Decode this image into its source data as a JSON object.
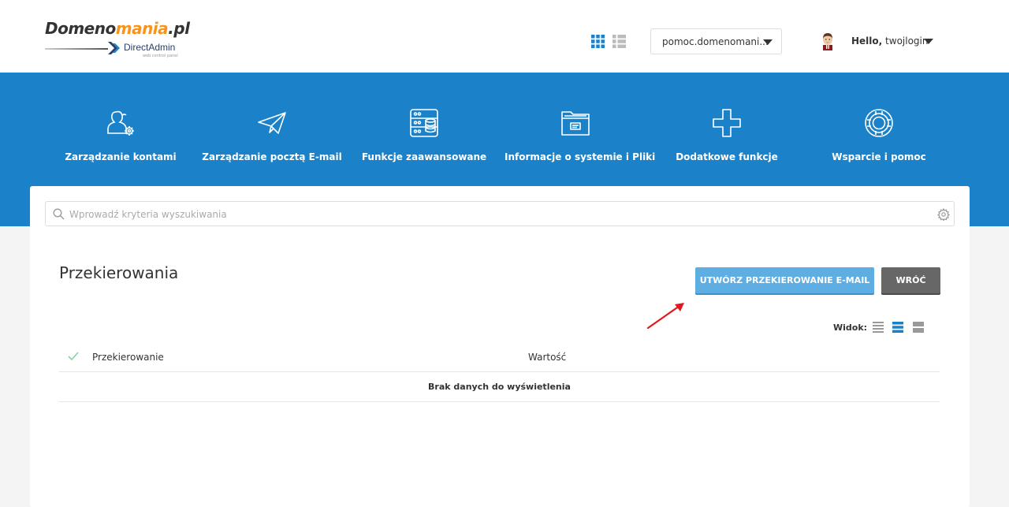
{
  "logo": {
    "part1": "Domeno",
    "part2": "mania",
    "part3": ".pl",
    "sub": "DirectAdmin",
    "tagline": "web control panel"
  },
  "header": {
    "domain": "pomoc.domenomani...",
    "greeting": "Hello,",
    "username": "twojlogin"
  },
  "nav": {
    "items": [
      {
        "label": "Zarządzanie kontami",
        "icon": "users-gear-icon"
      },
      {
        "label": "Zarządzanie pocztą E-mail",
        "icon": "paper-plane-icon"
      },
      {
        "label": "Funkcje zaawansowane",
        "icon": "server-database-icon"
      },
      {
        "label": "Informacje o systemie i Pliki",
        "icon": "folder-icon"
      },
      {
        "label": "Dodatkowe funkcje",
        "icon": "plus-icon"
      },
      {
        "label": "Wsparcie i pomoc",
        "icon": "lifebuoy-icon"
      }
    ]
  },
  "search": {
    "placeholder": "Wprowadź kryteria wyszukiwania"
  },
  "page": {
    "title": "Przekierowania",
    "create_button": "UTWÓRZ PRZEKIEROWANIE E-MAIL",
    "back_button": "WRÓĆ",
    "view_label": "Widok:"
  },
  "table": {
    "columns": [
      "Przekierowanie",
      "Wartość"
    ],
    "empty_message": "Brak danych do wyświetlenia"
  },
  "colors": {
    "accent_blue": "#1b82c9",
    "button_blue": "#5eaee3",
    "button_gray": "#676767",
    "annotation_arrow": "#e0191c",
    "logo_orange": "#f7941d"
  }
}
